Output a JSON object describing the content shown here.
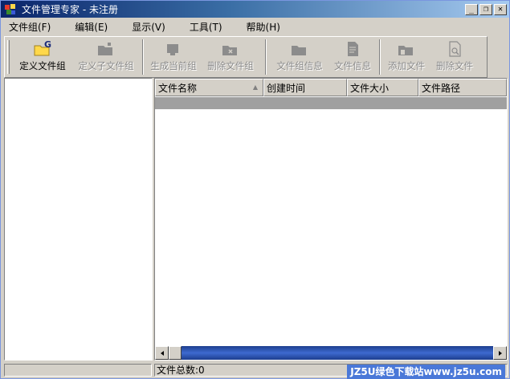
{
  "window": {
    "title": "文件管理专家 - 未注册"
  },
  "title_buttons": {
    "minimize": "_",
    "restore": "❐",
    "close": "✕"
  },
  "menubar": {
    "items": [
      {
        "label": "文件组(F)"
      },
      {
        "label": "编辑(E)"
      },
      {
        "label": "显示(V)"
      },
      {
        "label": "工具(T)"
      },
      {
        "label": "帮助(H)"
      }
    ]
  },
  "toolbar": {
    "define_group": "定义文件组",
    "define_subgroup": "定义子文件组",
    "generate_group": "生成当前组",
    "delete_group": "删除文件组",
    "group_info": "文件组信息",
    "file_info": "文件信息",
    "add_file": "添加文件",
    "delete_file": "删除文件"
  },
  "list": {
    "columns": [
      "文件名称",
      "创建时间",
      "文件大小",
      "文件路径"
    ]
  },
  "statusbar": {
    "left": "",
    "total_files": "文件总数:0",
    "watermark": "JZ5U绿色下载站www.jz5u.com"
  },
  "colors": {
    "titlebar": "#0a246a",
    "face": "#d4d0c8",
    "folder": "#ffd84a",
    "disabled_icon": "#8c8c8c"
  }
}
